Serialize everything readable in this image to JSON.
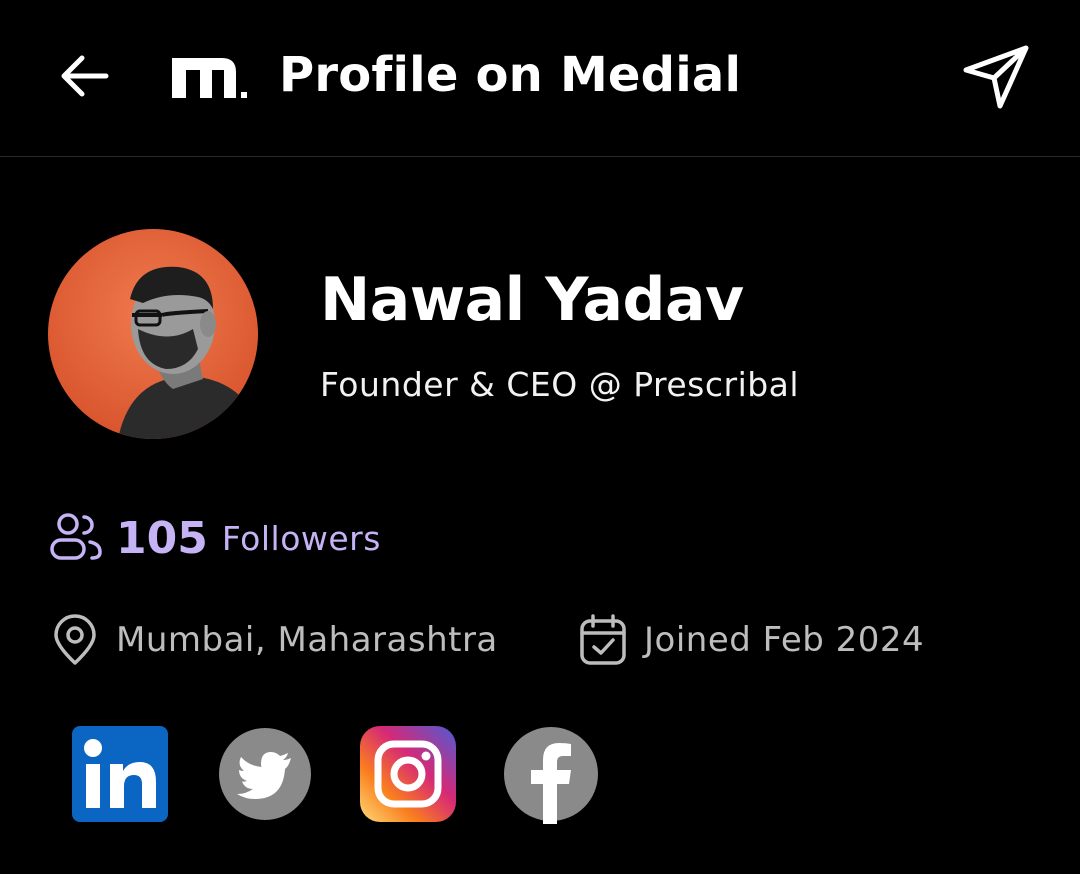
{
  "header": {
    "title": "Profile on Medial",
    "back_icon": "arrow-left-icon",
    "logo_icon": "medial-logo-icon",
    "share_icon": "send-paper-plane-icon"
  },
  "profile": {
    "name": "Nawal Yadav",
    "headline": "Founder & CEO @ Prescribal",
    "avatar_accent": "#e8673f"
  },
  "stats": {
    "followers_count": "105",
    "followers_label": "Followers",
    "followers_icon": "users-icon",
    "accent": "#c5b3f5"
  },
  "meta": {
    "location": "Mumbai, Maharashtra",
    "location_icon": "map-pin-icon",
    "joined": "Joined Feb 2024",
    "joined_icon": "calendar-check-icon"
  },
  "social_links": [
    {
      "name": "linkedin",
      "icon": "linkedin-icon",
      "color": "#0a66c2"
    },
    {
      "name": "twitter",
      "icon": "twitter-icon",
      "color": "#8a8a8a"
    },
    {
      "name": "instagram",
      "icon": "instagram-icon",
      "color": "#e1306c"
    },
    {
      "name": "facebook",
      "icon": "facebook-icon",
      "color": "#8a8a8a"
    }
  ]
}
